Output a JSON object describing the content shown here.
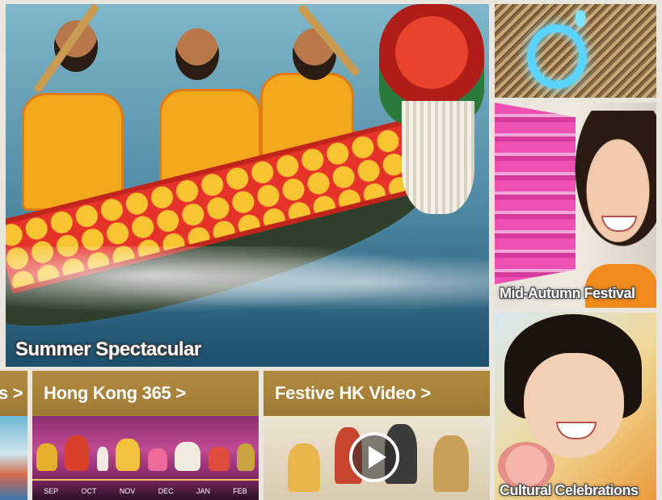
{
  "hero": {
    "caption": "Summer Spectacular"
  },
  "side_tiles": [
    {
      "id": "lantern",
      "caption": ""
    },
    {
      "id": "mid_autumn",
      "caption": "Mid-Autumn Festival"
    },
    {
      "id": "cultural",
      "caption": "Cultural Celebrations"
    }
  ],
  "bottom_links": [
    {
      "id": "prev",
      "label": "s >"
    },
    {
      "id": "hk365",
      "label": "Hong Kong 365 >"
    },
    {
      "id": "video",
      "label": "Festive HK Video  >"
    }
  ],
  "hk365_timeline": {
    "months": [
      "SEP",
      "OCT",
      "NOV",
      "DEC",
      "JAN",
      "FEB"
    ]
  },
  "icons": {
    "play": "play-icon"
  },
  "colors": {
    "header_gold": "#a98238",
    "caption_text": "#ffffff",
    "page_bg": "#e9e6df"
  }
}
